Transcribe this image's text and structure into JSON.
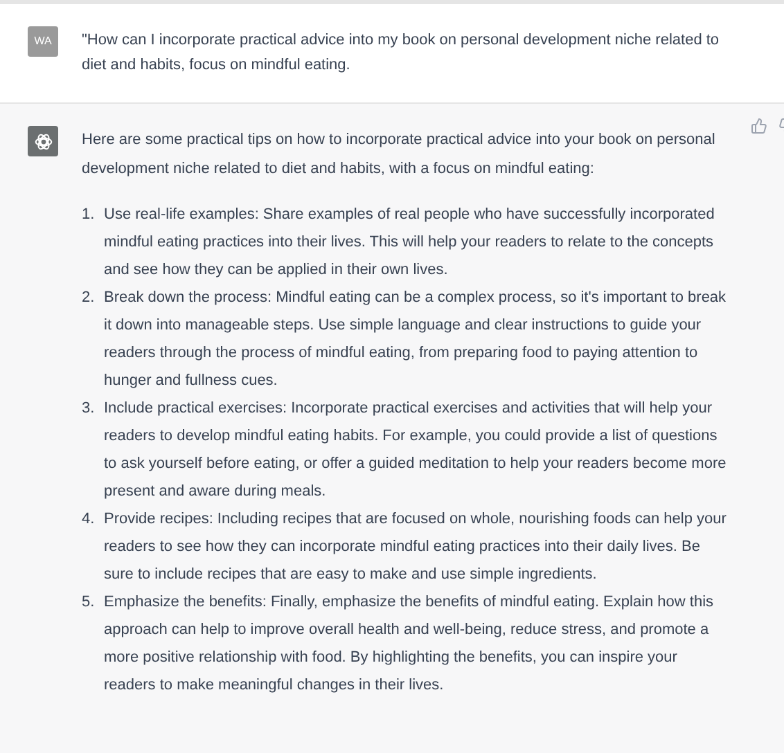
{
  "user_message": {
    "avatar": "WA",
    "text": "\"How can I incorporate practical advice into my book on personal development niche related to diet and habits, focus on mindful eating."
  },
  "assistant_message": {
    "intro": "Here are some practical tips on how to incorporate practical advice into your book on personal development niche related to diet and habits, with a focus on mindful eating:",
    "items": [
      {
        "number": "1.",
        "text": "Use real-life examples: Share examples of real people who have successfully incorporated mindful eating practices into their lives. This will help your readers to relate to the concepts and see how they can be applied in their own lives."
      },
      {
        "number": "2.",
        "text": "Break down the process: Mindful eating can be a complex process, so it's important to break it down into manageable steps. Use simple language and clear instructions to guide your readers through the process of mindful eating, from preparing food to paying attention to hunger and fullness cues."
      },
      {
        "number": "3.",
        "text": "Include practical exercises: Incorporate practical exercises and activities that will help your readers to develop mindful eating habits. For example, you could provide a list of questions to ask yourself before eating, or offer a guided meditation to help your readers become more present and aware during meals."
      },
      {
        "number": "4.",
        "text": "Provide recipes: Including recipes that are focused on whole, nourishing foods can help your readers to see how they can incorporate mindful eating practices into their daily lives. Be sure to include recipes that are easy to make and use simple ingredients."
      },
      {
        "number": "5.",
        "text": "Emphasize the benefits: Finally, emphasize the benefits of mindful eating. Explain how this approach can help to improve overall health and well-being, reduce stress, and promote a more positive relationship with food. By highlighting the benefits, you can inspire your readers to make meaningful changes in their lives."
      }
    ]
  }
}
